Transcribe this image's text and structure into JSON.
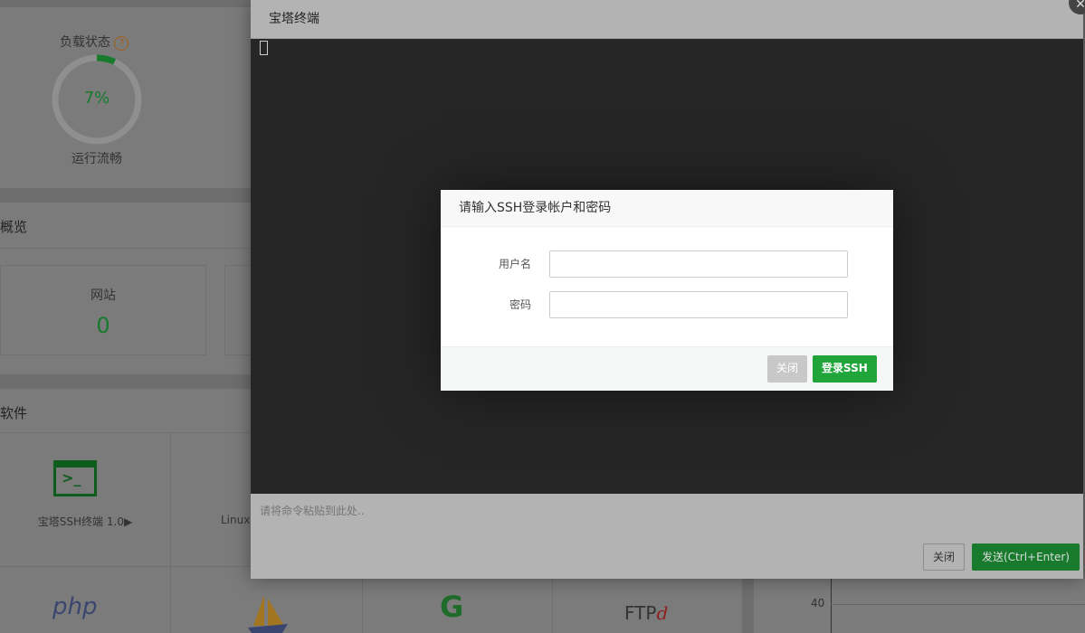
{
  "background": {
    "load": {
      "title": "负载状态",
      "help_icon": "question-circle-icon",
      "percent": 7,
      "percent_label": "7%",
      "status": "运行流畅"
    },
    "overview": {
      "title": "概览",
      "site_label": "网站",
      "site_count": "0"
    },
    "software": {
      "title": "软件",
      "items": [
        {
          "label": "宝塔SSH终端 1.0▶",
          "icon": "terminal-icon"
        },
        {
          "label": "Linux",
          "icon": "tools-icon"
        }
      ],
      "logos": [
        "php",
        "tomcat-icon",
        "g-icon",
        "FTP"
      ]
    },
    "chart": {
      "tick": "40"
    }
  },
  "terminal": {
    "title": "宝塔终端",
    "paste_placeholder": "请将命令粘贴到此处..",
    "close_label": "关闭",
    "send_label": "发送(Ctrl+Enter)",
    "accent": "#20a53a"
  },
  "dialog": {
    "title": "请输入SSH登录帐户和密码",
    "username_label": "用户名",
    "username_value": "",
    "password_label": "密码",
    "password_value": "",
    "close_label": "关闭",
    "login_label": "登录SSH"
  }
}
